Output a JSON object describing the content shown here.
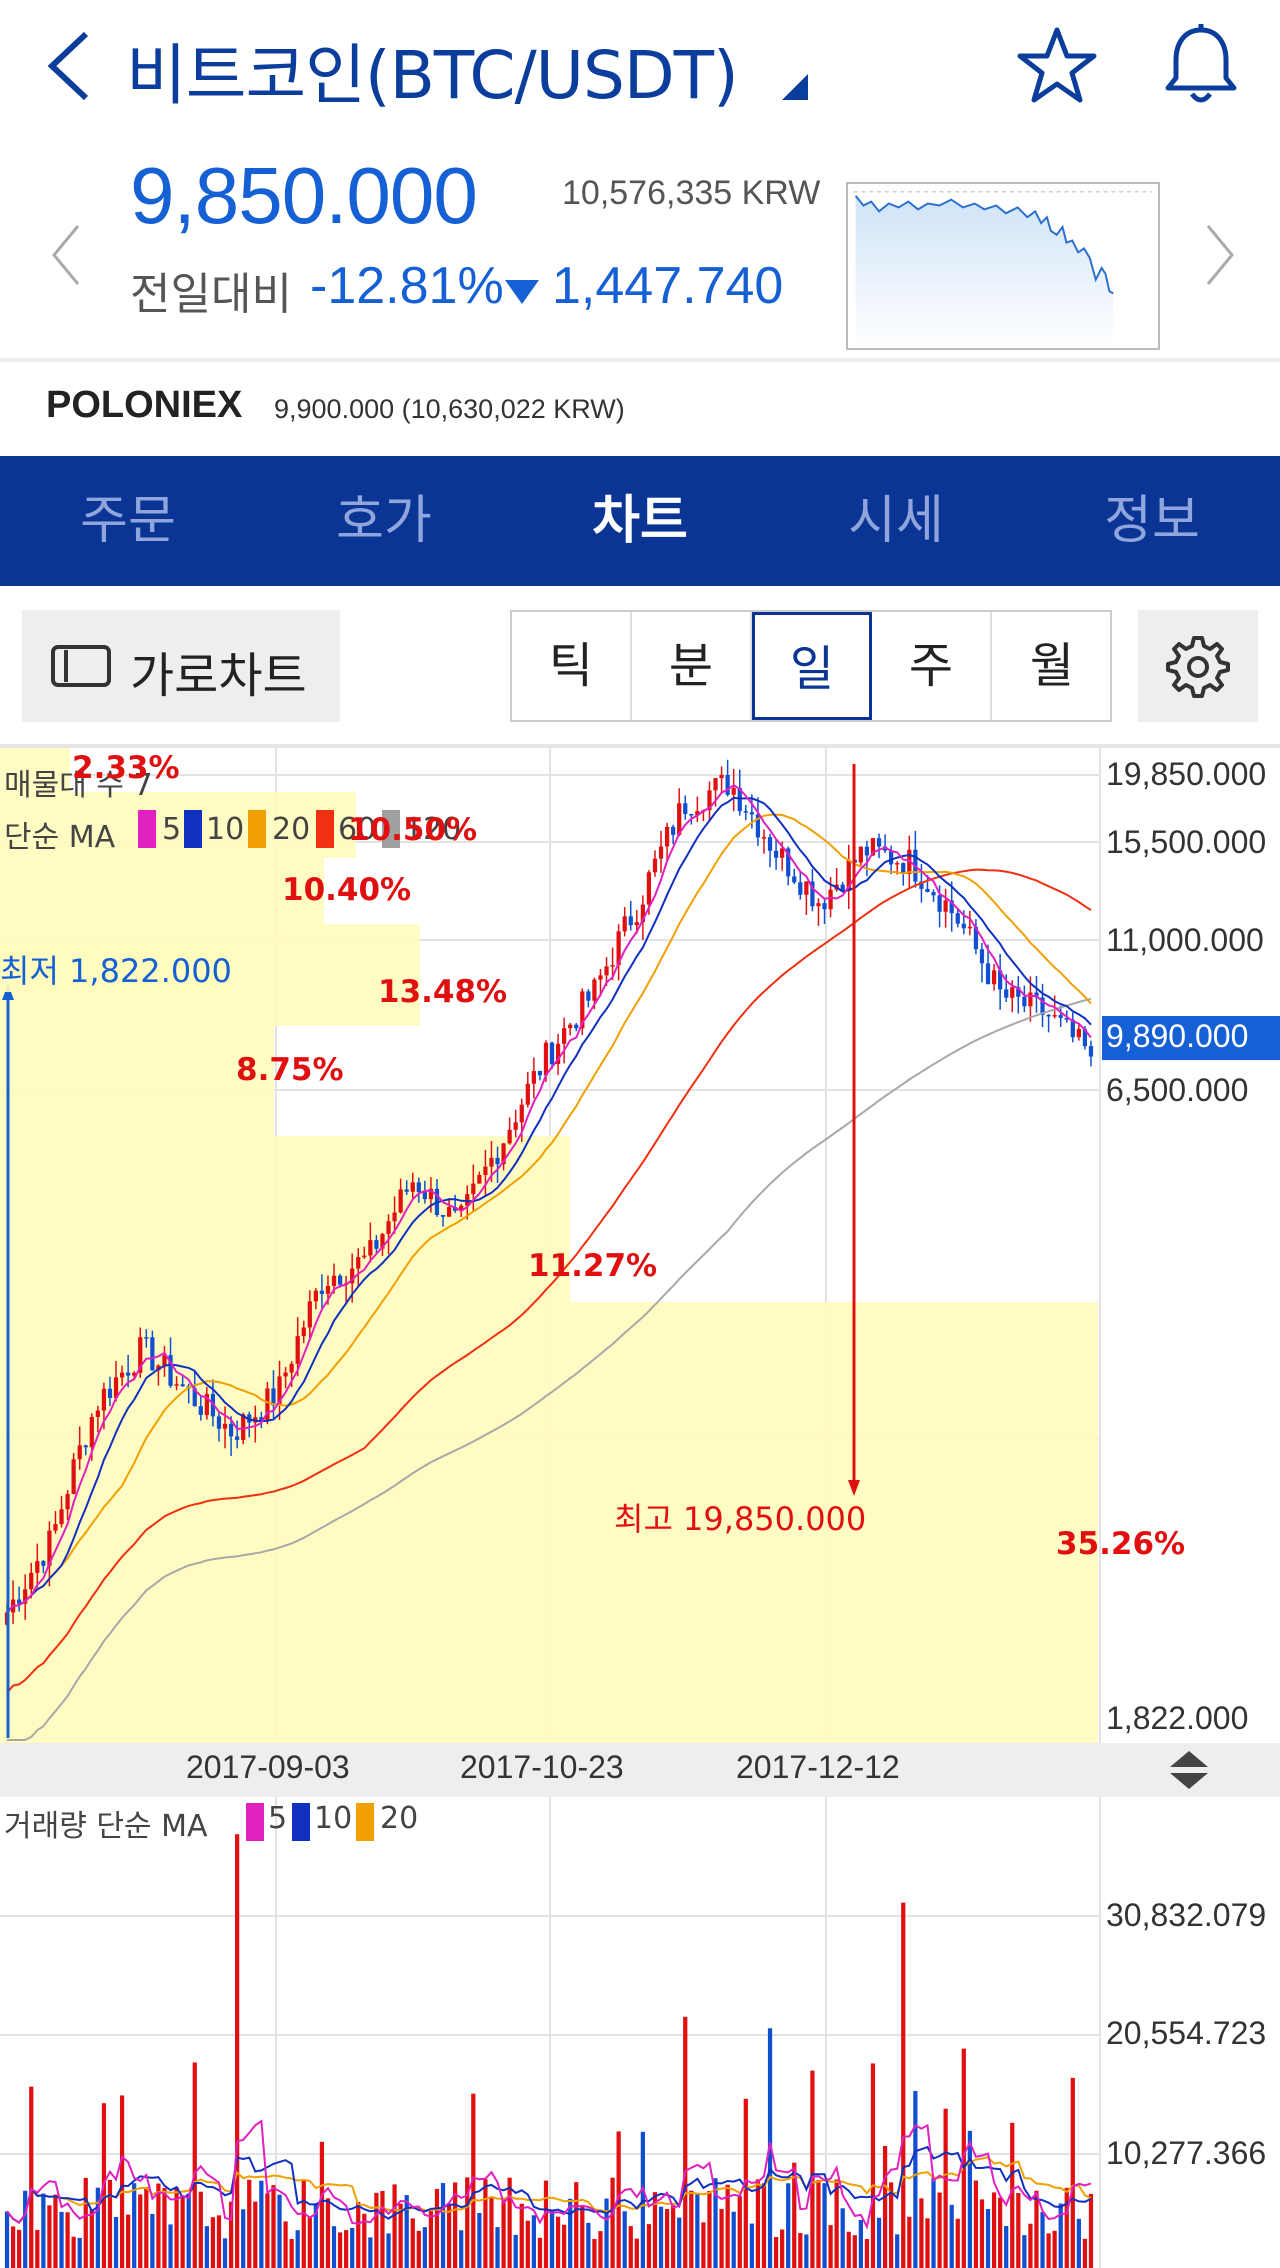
{
  "header": {
    "title": "비트코인(BTC/USDT)",
    "back_icon": "chevron-left-icon",
    "star_icon": "star-icon",
    "bell_icon": "bell-icon"
  },
  "summary": {
    "price": "9,850.000",
    "price_krw": "10,576,335 KRW",
    "diff_label": "전일대비",
    "diff_pct": "-12.81%",
    "diff_value": "1,447.740",
    "diff_direction": "down",
    "accent_color": "#1560d4"
  },
  "exchange": {
    "name": "POLONIEX",
    "price": "9,900.000 (10,630,022 KRW)"
  },
  "tabs": [
    {
      "label": "주문",
      "active": false
    },
    {
      "label": "호가",
      "active": false
    },
    {
      "label": "차트",
      "active": true
    },
    {
      "label": "시세",
      "active": false
    },
    {
      "label": "정보",
      "active": false
    }
  ],
  "toolbar": {
    "landscape_label": "가로차트",
    "periods": [
      {
        "label": "틱",
        "active": false
      },
      {
        "label": "분",
        "active": false
      },
      {
        "label": "일",
        "active": true
      },
      {
        "label": "주",
        "active": false
      },
      {
        "label": "월",
        "active": false
      }
    ]
  },
  "price_chart": {
    "overlay_profile_label": "매물대 수 7",
    "ma_label": "단순 MA",
    "ma_periods": [
      "5",
      "10",
      "20",
      "60",
      "120"
    ],
    "ma_colors": [
      "#e020c0",
      "#1030c0",
      "#f0a000",
      "#f03010",
      "#a0a0a0"
    ],
    "axis_ticks": [
      "19,850.000",
      "15,500.000",
      "11,000.000",
      "6,500.000",
      "1,822.000"
    ],
    "current_price_tag": "9,890.000",
    "low_label": "최저 1,822.000",
    "high_label": "최고 19,850.000",
    "profile_pcts": [
      "2.33%",
      "10.50%",
      "10.40%",
      "13.48%",
      "8.75%",
      "11.27%",
      "35.26%"
    ],
    "x_ticks": [
      "2017-09-03",
      "2017-10-23",
      "2017-12-12"
    ]
  },
  "volume_chart": {
    "label": "거래량 단순 MA",
    "ma_periods": [
      "5",
      "10",
      "20"
    ],
    "axis_ticks": [
      "30,832.079",
      "20,554.723",
      "10,277.366"
    ]
  },
  "chart_data": [
    {
      "type": "candlestick",
      "title": "",
      "x_ticks": [
        "2017-09-03",
        "2017-10-23",
        "2017-12-12"
      ],
      "y_ticks": [
        19850,
        15500,
        11000,
        6500,
        1822
      ],
      "ylim": [
        1822,
        19850
      ],
      "low": 1822,
      "high": 19850,
      "last": 9890,
      "close_series_approx": [
        2500,
        3000,
        4200,
        4800,
        4300,
        3900,
        4300,
        5700,
        6000,
        7300,
        6500,
        8100,
        10000,
        11600,
        14500,
        18500,
        19500,
        16500,
        14500,
        16500,
        16000,
        14000,
        11500,
        11000,
        9890
      ],
      "volume_profile_pct": [
        2.33,
        10.5,
        10.4,
        13.48,
        8.75,
        11.27,
        35.26
      ],
      "moving_averages": [
        5,
        10,
        20,
        60,
        120
      ]
    },
    {
      "type": "bar",
      "title": "",
      "y_ticks": [
        30832.079,
        20554.723,
        10277.366
      ],
      "moving_averages": [
        5,
        10,
        20
      ]
    }
  ]
}
